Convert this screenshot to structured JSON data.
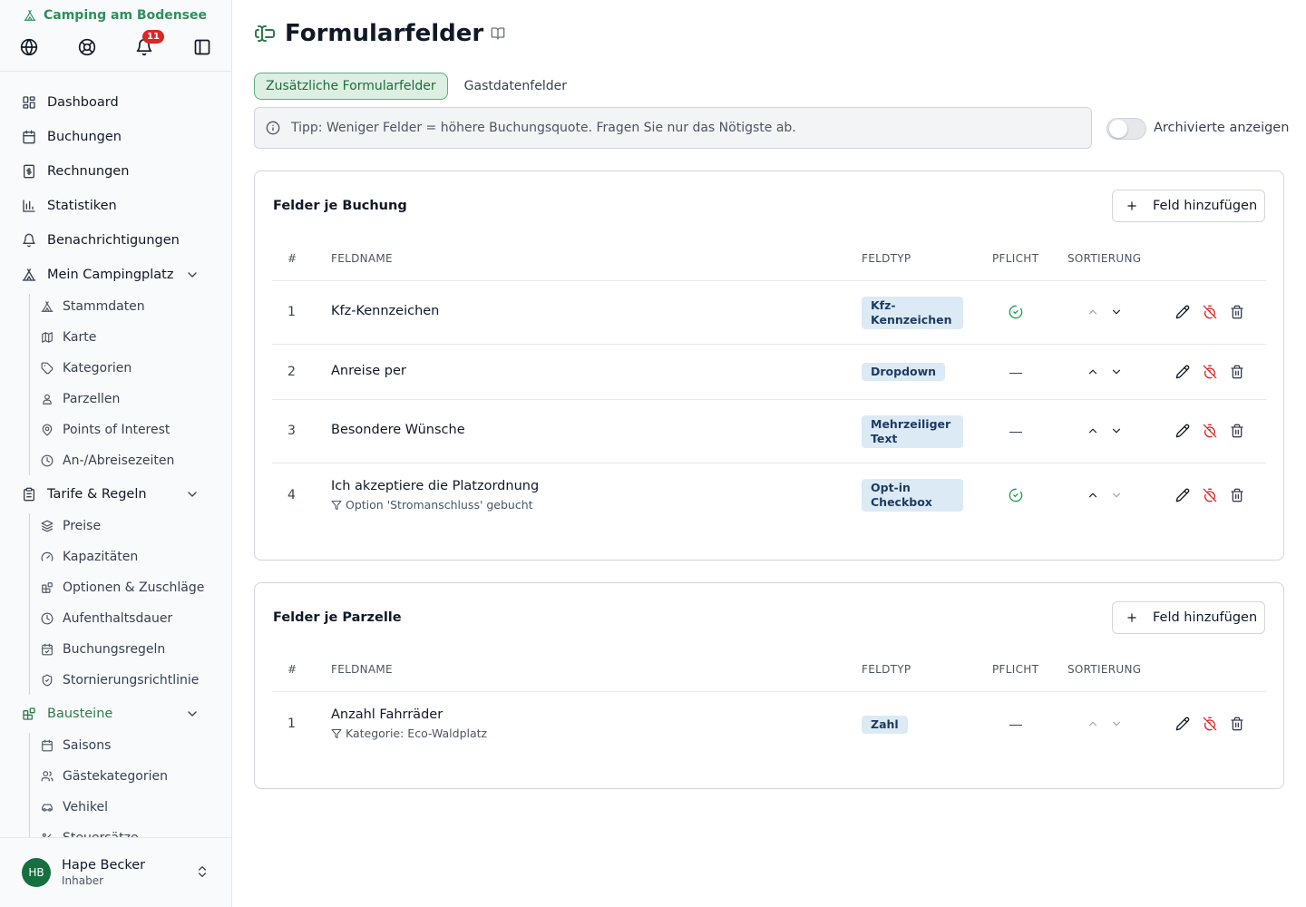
{
  "brand": {
    "name": "Camping am Bodensee"
  },
  "notifications": {
    "count": "11"
  },
  "sidebar": {
    "items": [
      {
        "label": "Dashboard"
      },
      {
        "label": "Buchungen"
      },
      {
        "label": "Rechnungen"
      },
      {
        "label": "Statistiken"
      },
      {
        "label": "Benachrichtigungen"
      },
      {
        "label": "Mein Campingplatz"
      },
      {
        "label": "Tarife & Regeln"
      },
      {
        "label": "Bausteine"
      }
    ],
    "mein_campingplatz": [
      {
        "label": "Stammdaten"
      },
      {
        "label": "Karte"
      },
      {
        "label": "Kategorien"
      },
      {
        "label": "Parzellen"
      },
      {
        "label": "Points of Interest"
      },
      {
        "label": "An-/Abreisezeiten"
      }
    ],
    "tarife": [
      {
        "label": "Preise"
      },
      {
        "label": "Kapazitäten"
      },
      {
        "label": "Optionen & Zuschläge"
      },
      {
        "label": "Aufenthaltsdauer"
      },
      {
        "label": "Buchungsregeln"
      },
      {
        "label": "Stornierungsrichtlinie"
      }
    ],
    "bausteine": [
      {
        "label": "Saisons"
      },
      {
        "label": "Gästekategorien"
      },
      {
        "label": "Vehikel"
      },
      {
        "label": "Steuersätze"
      }
    ]
  },
  "user": {
    "initials": "HB",
    "name": "Hape Becker",
    "role": "Inhaber"
  },
  "page": {
    "title": "Formularfelder",
    "tabs": [
      {
        "label": "Zusätzliche Formularfelder"
      },
      {
        "label": "Gastdatenfelder"
      }
    ],
    "tip": "Tipp: Weniger Felder = höhere Buchungsquote. Fragen Sie nur das Nötigste ab.",
    "archive_toggle_label": "Archivierte anzeigen"
  },
  "table_headers": {
    "num": "#",
    "name": "FELDNAME",
    "type": "FELDTYP",
    "required": "PFLICHT",
    "sort": "SORTIERUNG"
  },
  "buchung": {
    "title": "Felder je Buchung",
    "add_label": "Feld hinzufügen",
    "rows": [
      {
        "num": "1",
        "name": "Kfz-Kennzeichen",
        "type_l1": "Kfz-",
        "type_l2": "Kennzeichen"
      },
      {
        "num": "2",
        "name": "Anreise per",
        "type": "Dropdown"
      },
      {
        "num": "3",
        "name": "Besondere Wünsche",
        "type_l1": "Mehrzeiliger",
        "type_l2": "Text"
      },
      {
        "num": "4",
        "name": "Ich akzeptiere die Platzordnung",
        "condition": "Option 'Stromanschluss' gebucht",
        "type_l1": "Opt-in",
        "type_l2": "Checkbox"
      }
    ]
  },
  "parzelle": {
    "title": "Felder je Parzelle",
    "add_label": "Feld hinzufügen",
    "rows": [
      {
        "num": "1",
        "name": "Anzahl Fahrräder",
        "condition": "Kategorie: Eco-Waldplatz",
        "type": "Zahl"
      }
    ]
  }
}
